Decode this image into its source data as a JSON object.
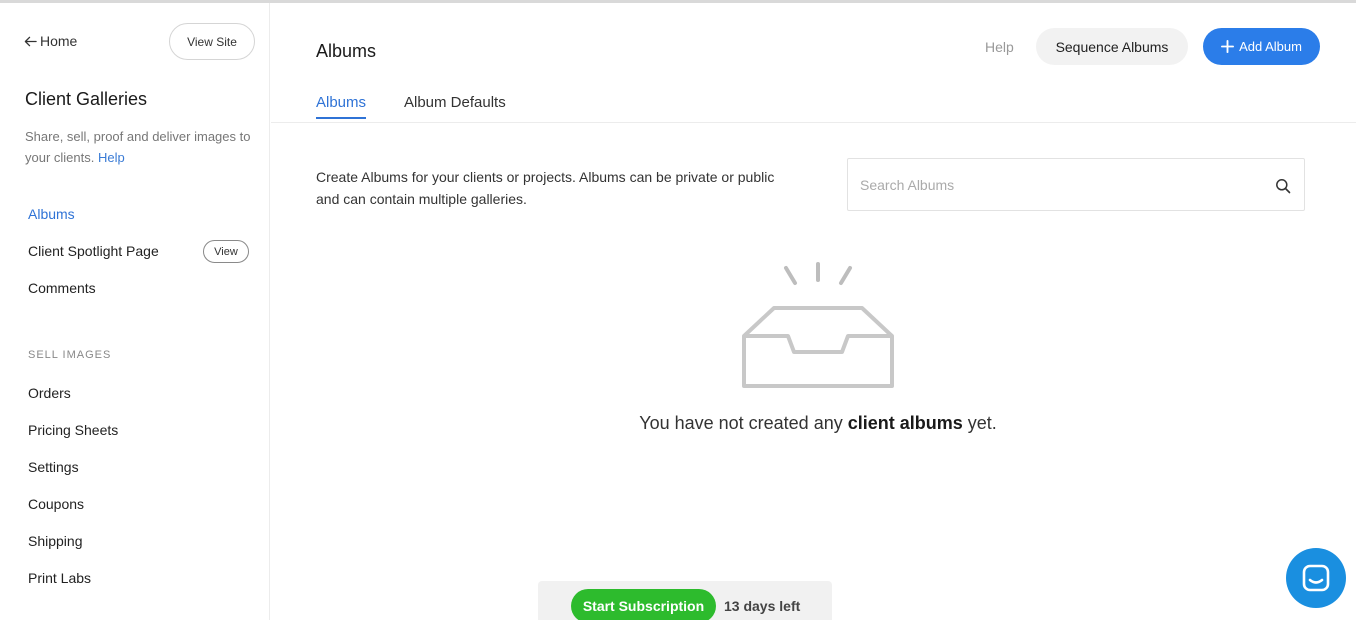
{
  "sidebar": {
    "home_label": "Home",
    "view_site_label": "View Site",
    "title": "Client Galleries",
    "description": "Share, sell, proof and deliver images to your clients.",
    "help_label": "Help",
    "nav": {
      "albums": "Albums",
      "client_spotlight": "Client Spotlight Page",
      "client_spotlight_view": "View",
      "comments": "Comments"
    },
    "sell_section_label": "SELL IMAGES",
    "sell_items": {
      "orders": "Orders",
      "pricing_sheets": "Pricing Sheets",
      "settings": "Settings",
      "coupons": "Coupons",
      "shipping": "Shipping",
      "print_labs": "Print Labs"
    }
  },
  "main": {
    "title": "Albums",
    "help_label": "Help",
    "sequence_button": "Sequence Albums",
    "add_button": "Add Album",
    "tabs": {
      "albums": "Albums",
      "album_defaults": "Album Defaults"
    },
    "intro": "Create Albums for your clients or projects. Albums can be private or public and can contain multiple galleries.",
    "search": {
      "placeholder": "Search Albums",
      "value": ""
    },
    "empty": {
      "prefix": "You have not created any ",
      "bold": "client albums",
      "suffix": " yet."
    }
  },
  "subscription": {
    "start_label": "Start Subscription",
    "days_left": "13 days left"
  },
  "colors": {
    "accent": "#2f73d6",
    "add_button": "#2b7de9",
    "subscription_green": "#2dbb2d",
    "chat_blue": "#1a8fe0"
  },
  "icons": {
    "back": "arrow-left-icon",
    "plus": "plus-icon",
    "search": "search-icon",
    "empty": "inbox-tray-icon",
    "chat": "chat-icon"
  }
}
